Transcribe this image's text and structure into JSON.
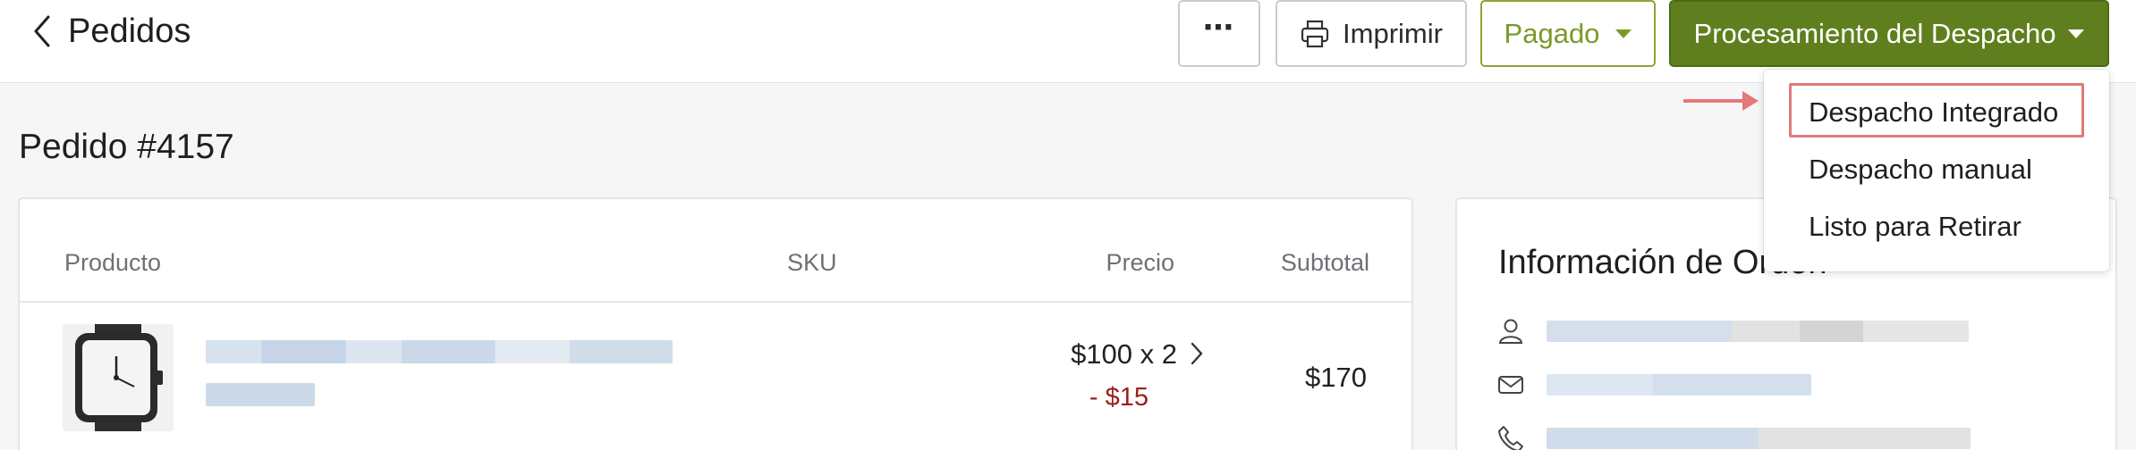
{
  "header": {
    "back_label": "Pedidos",
    "more_label": "⋯",
    "print_label": "Imprimir",
    "paid_label": "Pagado",
    "fulfill_label": "Procesamiento del Despacho"
  },
  "order": {
    "title": "Pedido #4157"
  },
  "products_table": {
    "columns": [
      "Producto",
      "SKU",
      "Precio",
      "Subtotal"
    ],
    "rows": [
      {
        "price": "$100 x 2",
        "discount": "- $15",
        "subtotal": "$170"
      }
    ]
  },
  "order_info": {
    "title": "Información de Orden"
  },
  "fulfillment_menu": {
    "items": [
      "Despacho Integrado",
      "Despacho manual",
      "Listo para Retirar"
    ]
  },
  "colors": {
    "brand_green": "#5f7f1f",
    "paid_green": "#7a9a27",
    "discount_red": "#9a1f1a",
    "annotation_red": "#e07a7a"
  }
}
